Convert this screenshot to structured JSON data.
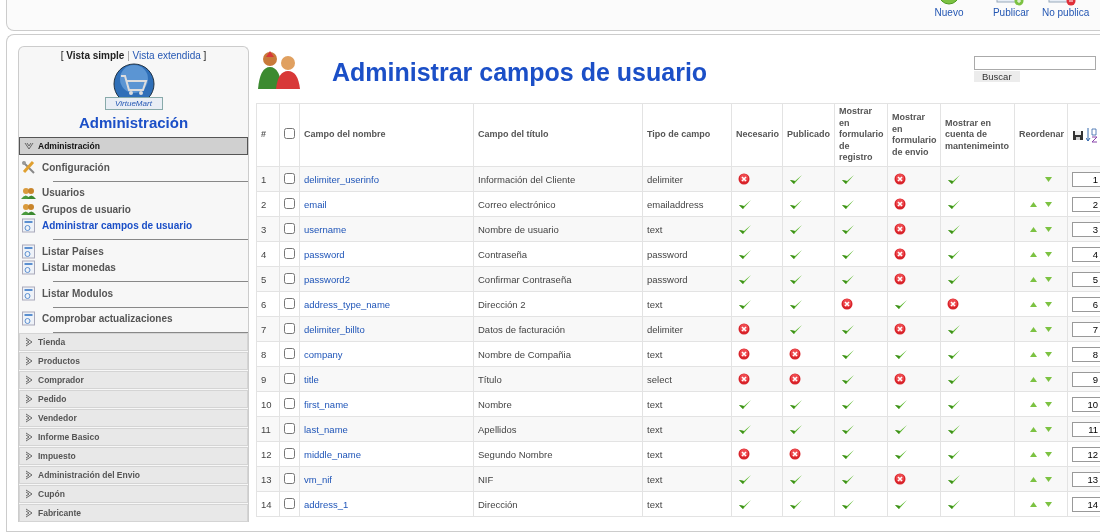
{
  "toolbar": {
    "buttons": [
      {
        "label": "Nuevo",
        "kind": "new"
      },
      {
        "label": "Publicar",
        "kind": "publish"
      },
      {
        "label": "No publica",
        "kind": "unpublish"
      }
    ]
  },
  "sidebar": {
    "view_switch": {
      "open": "[",
      "options": [
        {
          "label": "Vista simple",
          "selected": true
        },
        {
          "label": "Vista extendida",
          "selected": false
        }
      ],
      "separator": "|",
      "close": "]"
    },
    "logo_text": "VirtueMart",
    "heading": "Administración",
    "sections": [
      {
        "label": "Administración",
        "expanded": true,
        "groups": [
          [
            {
              "label": "Configuración",
              "kind": "tools",
              "selected": false
            }
          ],
          [
            {
              "label": "Usuarios",
              "kind": "users",
              "selected": false
            },
            {
              "label": "Grupos de usuario",
              "kind": "users",
              "selected": false
            },
            {
              "label": "Administrar campos de usuario",
              "kind": "page",
              "selected": true
            }
          ],
          [
            {
              "label": "Listar Países",
              "kind": "page",
              "selected": false
            },
            {
              "label": "Listar monedas",
              "kind": "page",
              "selected": false
            }
          ],
          [
            {
              "label": "Listar Modulos",
              "kind": "page",
              "selected": false
            }
          ],
          [
            {
              "label": "Comprobar actualizaciones",
              "kind": "page",
              "selected": false
            }
          ]
        ]
      },
      {
        "label": "Tienda",
        "expanded": false
      },
      {
        "label": "Productos",
        "expanded": false
      },
      {
        "label": "Comprador",
        "expanded": false
      },
      {
        "label": "Pedido",
        "expanded": false
      },
      {
        "label": "Vendedor",
        "expanded": false
      },
      {
        "label": "Informe Basico",
        "expanded": false
      },
      {
        "label": "Impuesto",
        "expanded": false
      },
      {
        "label": "Administración del Envio",
        "expanded": false
      },
      {
        "label": "Cupón",
        "expanded": false
      },
      {
        "label": "Fabricante",
        "expanded": false
      }
    ]
  },
  "page_title": "Administrar campos de usuario",
  "search": {
    "button": "Buscar"
  },
  "table": {
    "columns": [
      "#",
      "Campo del nombre",
      "Campo del título",
      "Tipo de campo",
      "Necesario",
      "Publicado",
      "Mostrar en formulario de registro",
      "Mostrar en formulario de envio",
      "Mostrar en cuenta de mantenimeinto",
      "Reordenar"
    ],
    "select_all": {
      "checked": false
    },
    "rows": [
      {
        "num": "1",
        "checked": false,
        "name": "delimiter_userinfo",
        "title": "Información del Cliente",
        "type": "delimiter",
        "required": false,
        "published": true,
        "registration": true,
        "shipping": false,
        "account": true,
        "up": false,
        "down": true,
        "order": "1"
      },
      {
        "num": "2",
        "checked": false,
        "name": "email",
        "title": "Correo electrónico",
        "type": "emailaddress",
        "required": true,
        "published": true,
        "registration": true,
        "shipping": false,
        "account": true,
        "up": true,
        "down": true,
        "order": "2"
      },
      {
        "num": "3",
        "checked": false,
        "name": "username",
        "title": "Nombre de usuario",
        "type": "text",
        "required": true,
        "published": true,
        "registration": true,
        "shipping": false,
        "account": true,
        "up": true,
        "down": true,
        "order": "3"
      },
      {
        "num": "4",
        "checked": false,
        "name": "password",
        "title": "Contraseña",
        "type": "password",
        "required": true,
        "published": true,
        "registration": true,
        "shipping": false,
        "account": true,
        "up": true,
        "down": true,
        "order": "4"
      },
      {
        "num": "5",
        "checked": false,
        "name": "password2",
        "title": "Confirmar Contraseña",
        "type": "password",
        "required": true,
        "published": true,
        "registration": true,
        "shipping": false,
        "account": true,
        "up": true,
        "down": true,
        "order": "5"
      },
      {
        "num": "6",
        "checked": false,
        "name": "address_type_name",
        "title": "Dirección 2",
        "type": "text",
        "required": true,
        "published": true,
        "registration": false,
        "shipping": true,
        "account": false,
        "up": true,
        "down": true,
        "order": "6"
      },
      {
        "num": "7",
        "checked": false,
        "name": "delimiter_billto",
        "title": "Datos de facturación",
        "type": "delimiter",
        "required": false,
        "published": true,
        "registration": true,
        "shipping": false,
        "account": true,
        "up": true,
        "down": true,
        "order": "7"
      },
      {
        "num": "8",
        "checked": false,
        "name": "company",
        "title": "Nombre de Compañia",
        "type": "text",
        "required": false,
        "published": false,
        "registration": true,
        "shipping": true,
        "account": true,
        "up": true,
        "down": true,
        "order": "8"
      },
      {
        "num": "9",
        "checked": false,
        "name": "title",
        "title": "Título",
        "type": "select",
        "required": false,
        "published": false,
        "registration": true,
        "shipping": false,
        "account": true,
        "up": true,
        "down": true,
        "order": "9"
      },
      {
        "num": "10",
        "checked": false,
        "name": "first_name",
        "title": "Nombre",
        "type": "text",
        "required": true,
        "published": true,
        "registration": true,
        "shipping": true,
        "account": true,
        "up": true,
        "down": true,
        "order": "10"
      },
      {
        "num": "11",
        "checked": false,
        "name": "last_name",
        "title": "Apellidos",
        "type": "text",
        "required": true,
        "published": true,
        "registration": true,
        "shipping": true,
        "account": true,
        "up": true,
        "down": true,
        "order": "11"
      },
      {
        "num": "12",
        "checked": false,
        "name": "middle_name",
        "title": "Segundo Nombre",
        "type": "text",
        "required": false,
        "published": false,
        "registration": true,
        "shipping": true,
        "account": true,
        "up": true,
        "down": true,
        "order": "12"
      },
      {
        "num": "13",
        "checked": false,
        "name": "vm_nif",
        "title": "NIF",
        "type": "text",
        "required": true,
        "published": true,
        "registration": true,
        "shipping": false,
        "account": true,
        "up": true,
        "down": true,
        "order": "13"
      },
      {
        "num": "14",
        "checked": false,
        "name": "address_1",
        "title": "Dirección",
        "type": "text",
        "required": true,
        "published": true,
        "registration": true,
        "shipping": true,
        "account": true,
        "up": true,
        "down": true,
        "order": "14"
      }
    ]
  }
}
